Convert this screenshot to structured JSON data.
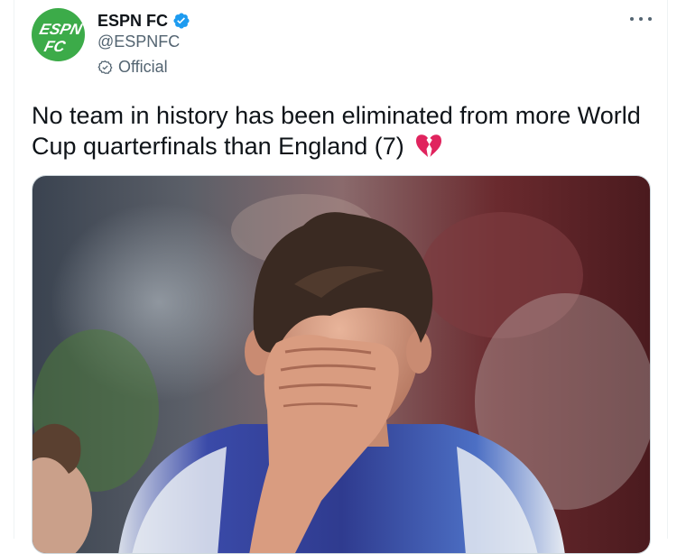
{
  "account": {
    "display_name": "ESPN FC",
    "handle": "@ESPNFC",
    "official_label": "Official",
    "avatar_text": [
      "ESPN",
      "FC"
    ],
    "verified": true
  },
  "tweet": {
    "text": "No team in history has been eliminated from more World Cup quarterfinals than England (7)",
    "emoji": "broken-heart-icon"
  },
  "media": {
    "type": "photo",
    "subject": "player-covering-face"
  },
  "colors": {
    "avatar_bg": "#3cab49",
    "verified_blue": "#1d9bf0",
    "secondary_text": "#536471",
    "broken_heart": "#e0245e"
  },
  "icons": [
    "verified-badge-icon",
    "official-check-icon",
    "more-options-icon",
    "broken-heart-icon"
  ]
}
